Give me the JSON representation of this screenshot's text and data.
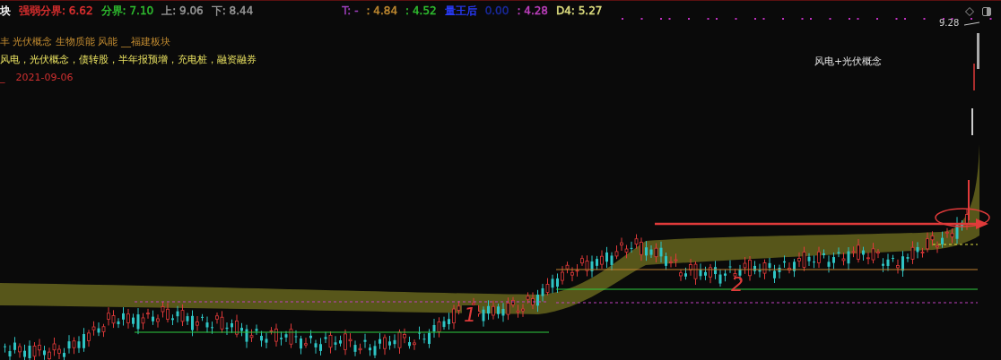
{
  "header": [
    {
      "label": "块",
      "color": "#ffffff"
    },
    {
      "label": "强弱分界:",
      "value": "6.62",
      "color": "#e03030"
    },
    {
      "label": "分界:",
      "value": "7.10",
      "color": "#30c030"
    },
    {
      "label": "上:",
      "value": "9.06",
      "color": "#9a9a9a"
    },
    {
      "label": "下:",
      "value": "8.44",
      "color": "#9a9a9a"
    },
    {
      "label": "T: -",
      "color": "#a040c0"
    },
    {
      "label": ":",
      "value": "4.84",
      "color": "#c08a30"
    },
    {
      "label": ":",
      "value": "4.52",
      "color": "#30c030"
    },
    {
      "label": "量王后",
      "color": "#2a3cff"
    },
    {
      "value": "0.00",
      "color": "#1a2aa0"
    },
    {
      "label": ":",
      "value": "4.28",
      "color": "#c040c0"
    },
    {
      "label": "D4:",
      "value": "5.27",
      "color": "#e0e080"
    }
  ],
  "sectors": "丰 光伏概念 生物质能 风能 __福建板块",
  "concepts": "风电，光伏概念，债转股，半年报预增，充电桩，融资融券",
  "date_mark": "_",
  "date": "2021-09-06",
  "chart": {
    "note": "风电+光伏概念",
    "price_label": "9.28",
    "marks": [
      "1",
      "2"
    ]
  }
}
